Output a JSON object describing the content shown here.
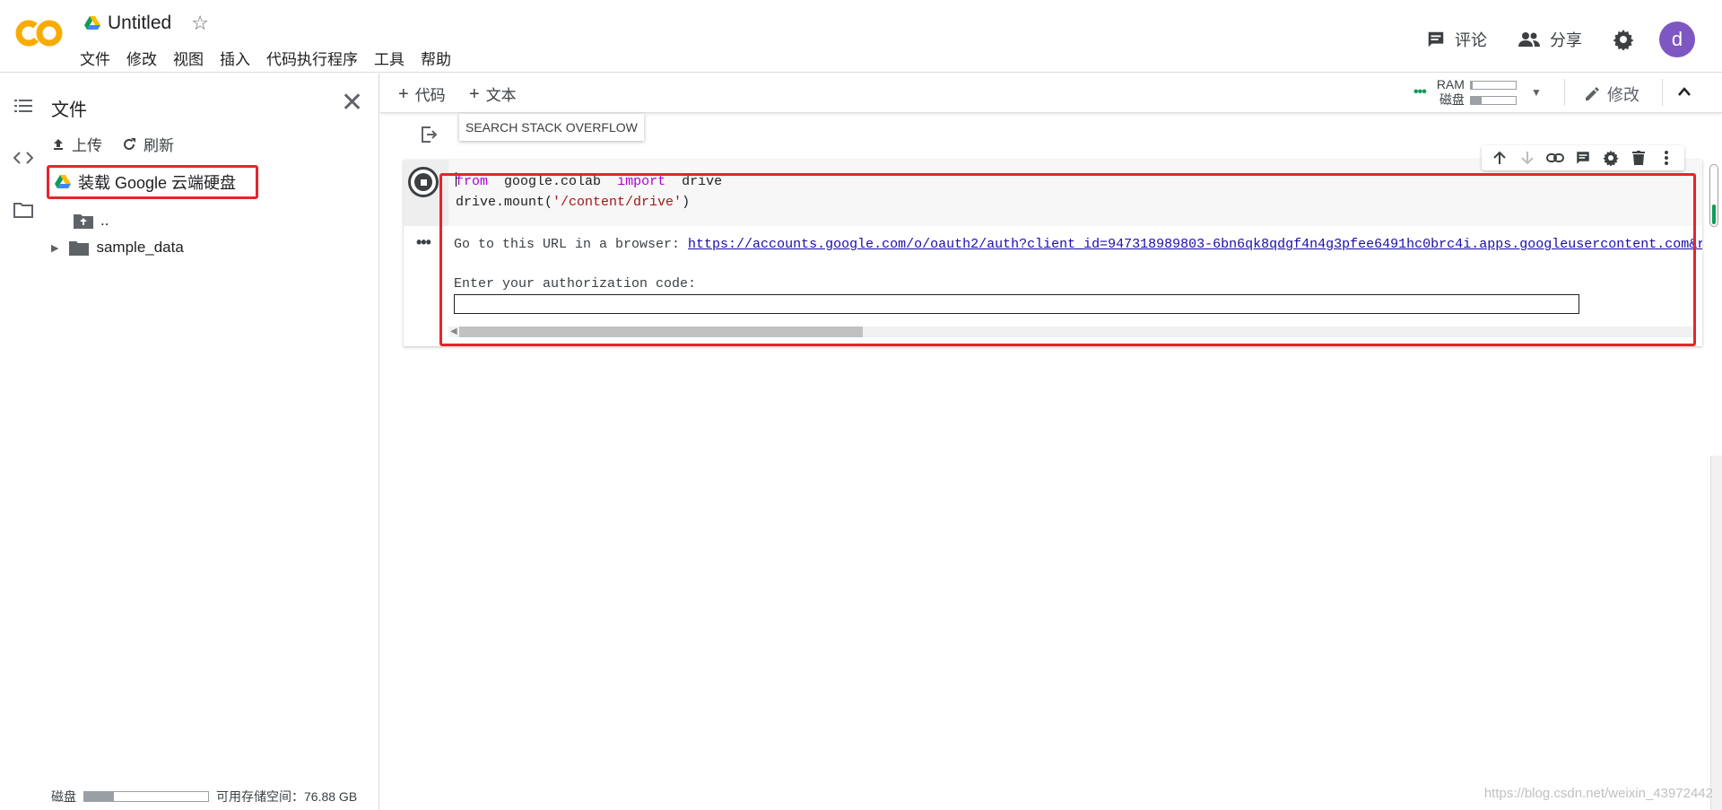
{
  "app": {
    "doc_title": "Untitled",
    "menu": [
      "文件",
      "修改",
      "视图",
      "插入",
      "代码执行程序",
      "工具",
      "帮助"
    ],
    "comment_label": "评论",
    "share_label": "分享",
    "avatar_letter": "d",
    "avatar_color": "#7e57c2"
  },
  "files_panel": {
    "title": "文件",
    "upload_label": "上传",
    "refresh_label": "刷新",
    "mount_drive_label": "装载 Google 云端硬盘",
    "tree": [
      {
        "name": "..",
        "type": "parent-folder"
      },
      {
        "name": "sample_data",
        "type": "folder",
        "expandable": true
      }
    ],
    "disk_label": "磁盘",
    "disk_usage": 0.24,
    "available_label": "可用存储空间：76.88 GB"
  },
  "toolbar": {
    "add_code_label": "代码",
    "add_text_label": "文本",
    "ram_label": "RAM",
    "disk_label": "磁盘",
    "ram_usage": 0.04,
    "disk_usage": 0.24,
    "edit_label": "修改",
    "status_color": "#0f9d58"
  },
  "tooltip": "SEARCH STACK OVERFLOW",
  "cell": {
    "code_line1": {
      "kw1": "from",
      "mod": "google.colab",
      "kw2": "import",
      "name": "drive"
    },
    "code_line2": {
      "prefix": "drive.mount(",
      "str": "'/content/drive'",
      "suffix": ")"
    },
    "output_prefix": "Go to this URL in a browser: ",
    "output_url": "https://accounts.google.com/o/oauth2/auth?client_id=947318989803-6bn6qk8qdgf4n4g3pfee6491hc0brc4i.apps.googleusercontent.com&r",
    "auth_prompt": "Enter your authorization code:",
    "highlight_color": "#e8232b"
  },
  "watermark": "https://blog.csdn.net/weixin_43972442"
}
